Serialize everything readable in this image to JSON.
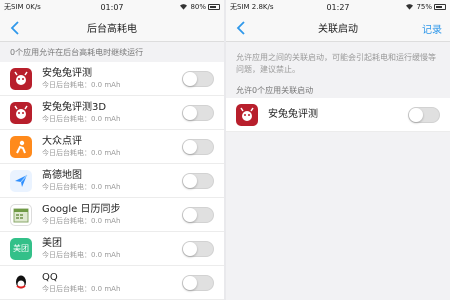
{
  "left": {
    "status": {
      "carrier": "无SIM 0K/s",
      "time": "01:07",
      "battery": "80%",
      "battery_level": 0.8
    },
    "nav": {
      "title": "后台高耗电"
    },
    "section_label": "0个应用允许在后台高耗电时继续运行",
    "apps": [
      {
        "name": "安兔兔评测",
        "sub": "今日后台耗电：0.0 mAh",
        "icon": "antutu-icon",
        "enabled": false
      },
      {
        "name": "安兔兔评测3D",
        "sub": "今日后台耗电：0.0 mAh",
        "icon": "antutu-3d-icon",
        "enabled": false
      },
      {
        "name": "大众点评",
        "sub": "今日后台耗电：0.0 mAh",
        "icon": "dianping-icon",
        "enabled": false
      },
      {
        "name": "高德地图",
        "sub": "今日后台耗电：0.0 mAh",
        "icon": "amap-icon",
        "enabled": false
      },
      {
        "name": "Google 日历同步",
        "sub": "今日后台耗电：0.0 mAh",
        "icon": "google-calendar-icon",
        "enabled": false
      },
      {
        "name": "美团",
        "sub": "今日后台耗电：0.0 mAh",
        "icon": "meituan-icon",
        "icon_text": "美团",
        "enabled": false
      },
      {
        "name": "QQ",
        "sub": "今日后台耗电：0.0 mAh",
        "icon": "qq-icon",
        "enabled": false
      }
    ]
  },
  "right": {
    "status": {
      "carrier": "无SIM 2.8K/s",
      "time": "01:27",
      "battery": "75%",
      "battery_level": 0.75
    },
    "nav": {
      "title": "关联启动",
      "action": "记录"
    },
    "description": "允许应用之间的关联启动，可能会引起耗电和运行缓慢等问题，建议禁止。",
    "section_label": "允许0个应用关联启动",
    "apps": [
      {
        "name": "安兔兔评测",
        "icon": "antutu-icon",
        "enabled": false
      }
    ]
  }
}
